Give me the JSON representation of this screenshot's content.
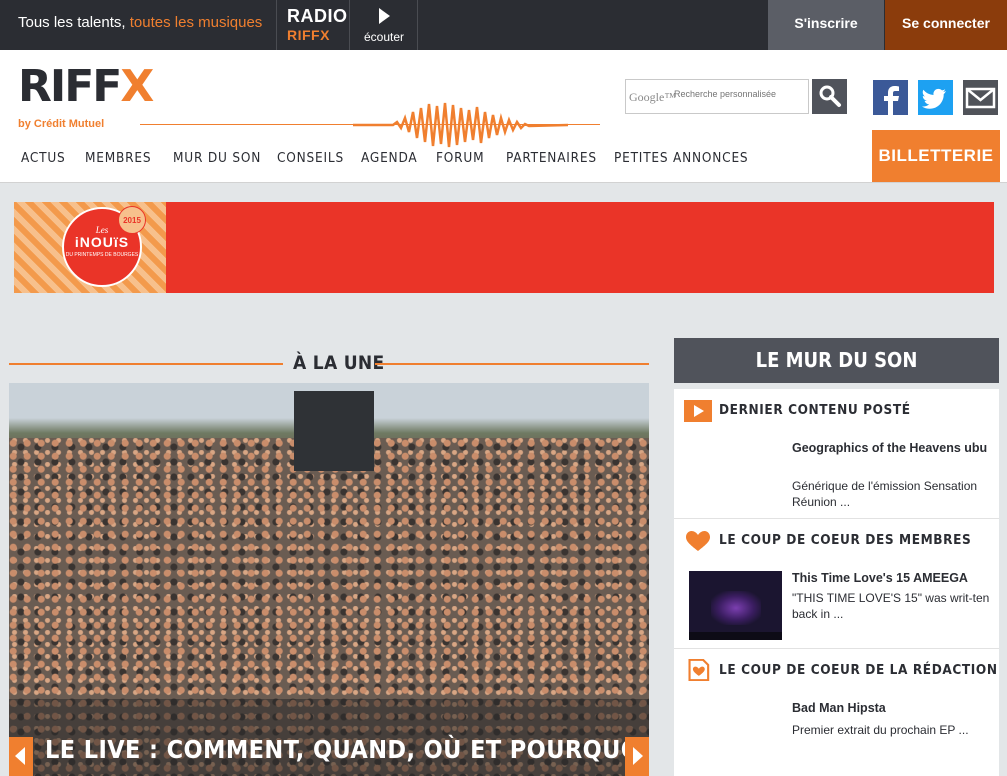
{
  "topbar": {
    "tagline_a": "Tous les talents,",
    "tagline_b": "toutes les musiques",
    "radio_label": "RADIO",
    "radio_name": "RIFFX",
    "listen_label": "écouter",
    "signup": "S'inscrire",
    "login": "Se connecter"
  },
  "header": {
    "logo_a": "RIFF",
    "logo_b": "X",
    "byline": "by Crédit Mutuel",
    "search_brand": "Google™",
    "search_placeholder": "Recherche personnalisée",
    "ticketing": "BILLETTERIE"
  },
  "nav": [
    "ACTUS",
    "MEMBRES",
    "MUR DU SON",
    "CONSEILS",
    "AGENDA",
    "FORUM",
    "PARTENAIRES",
    "PETITES ANNONCES"
  ],
  "banner": {
    "brand_small": "Les",
    "brand": "iNOUïS",
    "brand_sub": "DU PRINTEMPS DE BOURGES",
    "year": "2015"
  },
  "headline": {
    "section": "À LA UNE",
    "caption": "LE LIVE : COMMENT, QUAND, OÙ ET POURQUOI ?"
  },
  "mur": {
    "title": "LE MUR DU SON",
    "sections": [
      {
        "heading": "DERNIER CONTENU POSTÉ",
        "item_title": "Geographics of the Heavens ubu",
        "item_desc": "Générique de l'émission Sensation Réunion ..."
      },
      {
        "heading": "LE COUP DE COEUR DES MEMBRES",
        "item_title": "This Time Love's 15 AMEEGA",
        "item_desc": "\"THIS TIME LOVE'S 15\" was writ-ten back in ..."
      },
      {
        "heading": "LE COUP DE COEUR DE LA RÉDACTION",
        "item_title": "Bad Man Hipsta",
        "item_desc": "Premier extrait du prochain EP ..."
      }
    ]
  },
  "colors": {
    "accent": "#f07f2f",
    "dark": "#2b2d33",
    "banner_red": "#ea3428"
  }
}
